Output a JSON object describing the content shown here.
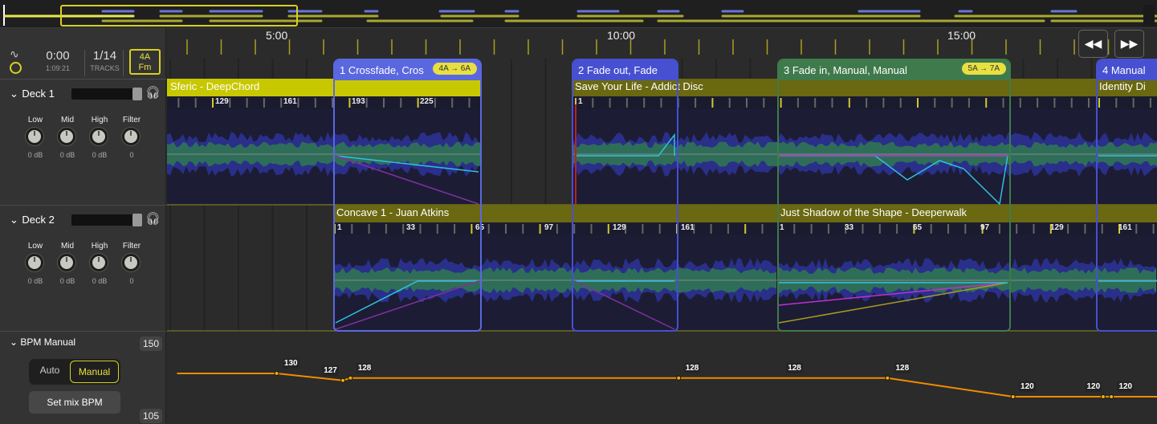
{
  "header": {
    "time": "0:00",
    "total_time": "1:09:21",
    "track_count": "1/14",
    "tracks_label": "TRACKS",
    "key": "4A",
    "key_mode": "Fm"
  },
  "ruler": {
    "labels": [
      "5:00",
      "10:00",
      "15:00"
    ],
    "rewind_icon": "rewind-icon",
    "forward_icon": "fast-forward-icon"
  },
  "decks": [
    {
      "name": "Deck 1",
      "eq": [
        {
          "label": "Low",
          "value": "0 dB"
        },
        {
          "label": "Mid",
          "value": "0 dB"
        },
        {
          "label": "High",
          "value": "0 dB"
        },
        {
          "label": "Filter",
          "value": "0"
        }
      ],
      "tracks": [
        {
          "title": "Sferic - DeepChord",
          "beats": [
            "129",
            "161",
            "193",
            "225"
          ]
        },
        {
          "title": "Save Your Life - Addict Disc",
          "beats": [
            "1"
          ]
        },
        {
          "title": "Identity Di",
          "beats": []
        }
      ]
    },
    {
      "name": "Deck 2",
      "eq": [
        {
          "label": "Low",
          "value": "0 dB"
        },
        {
          "label": "Mid",
          "value": "0 dB"
        },
        {
          "label": "High",
          "value": "0 dB"
        },
        {
          "label": "Filter",
          "value": "0"
        }
      ],
      "tracks": [
        {
          "title": "Concave 1 - Juan Atkins",
          "beats": [
            "1",
            "33",
            "65",
            "97",
            "129",
            "161"
          ]
        },
        {
          "title": "Just Shadow of the Shape - Deeperwalk",
          "beats": [
            "1",
            "33",
            "65",
            "97",
            "129",
            "161"
          ]
        }
      ]
    }
  ],
  "transitions": [
    {
      "title": "1 Crossfade, Cros",
      "key_change": "4A → 6A",
      "color": "#5a68e0"
    },
    {
      "title": "2 Fade out, Fade",
      "key_change": "",
      "color": "#4650d0"
    },
    {
      "title": "3 Fade in, Manual, Manual",
      "key_change": "5A → 7A",
      "color": "#3f7a4c"
    },
    {
      "title": "4 Manual",
      "key_change": "",
      "color": "#4650d0"
    }
  ],
  "bpm": {
    "title": "BPM Manual",
    "max": "150",
    "min": "105",
    "auto_label": "Auto",
    "manual_label": "Manual",
    "mode": "Manual",
    "set_label": "Set mix BPM",
    "line_color": "#f08c00",
    "points": [
      [
        3.5,
        130
      ],
      [
        4.96,
        130
      ],
      [
        5.93,
        127
      ],
      [
        6.04,
        128
      ],
      [
        10.85,
        128
      ],
      [
        13.91,
        128
      ],
      [
        15.75,
        120
      ],
      [
        17.07,
        120
      ],
      [
        17.19,
        120
      ],
      [
        17.86,
        120
      ]
    ],
    "labels": [
      {
        "t": 5.14,
        "v": "130"
      },
      {
        "t": 5.72,
        "v": "127"
      },
      {
        "t": 6.22,
        "v": "128"
      },
      {
        "t": 11.02,
        "v": "128"
      },
      {
        "t": 12.52,
        "v": "128"
      },
      {
        "t": 14.1,
        "v": "128"
      },
      {
        "t": 15.93,
        "v": "120"
      },
      {
        "t": 16.9,
        "v": "120"
      },
      {
        "t": 17.37,
        "v": "120"
      }
    ]
  }
}
